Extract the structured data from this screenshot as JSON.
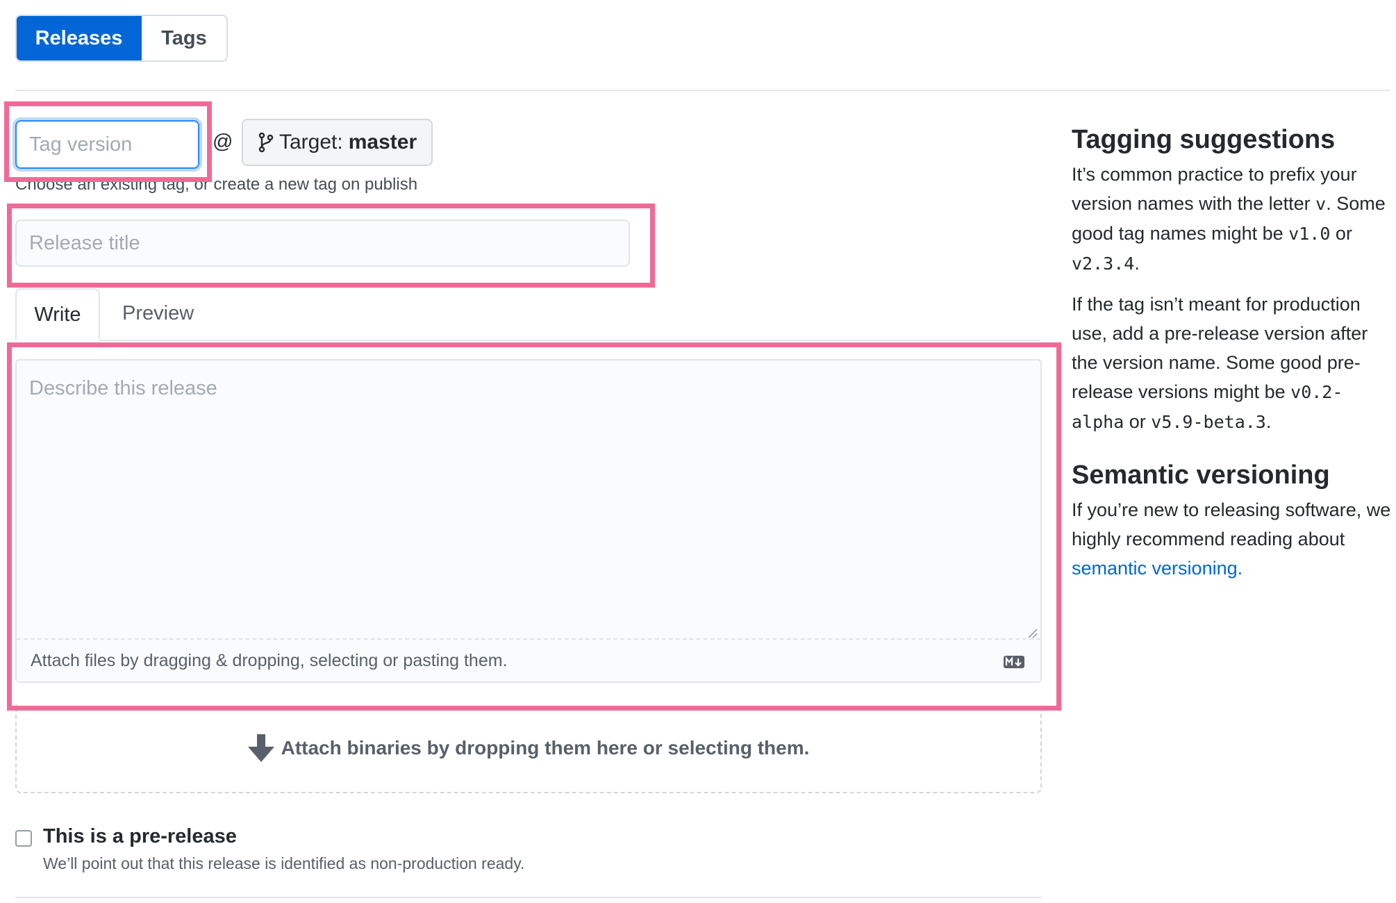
{
  "tabs": {
    "releases": "Releases",
    "tags": "Tags"
  },
  "tag_input": {
    "placeholder": "Tag version"
  },
  "at_sign": "@",
  "target": {
    "label": "Target:",
    "branch": "master"
  },
  "tag_hint": "Choose an existing tag, or create a new tag on publish",
  "release_title": {
    "placeholder": "Release title"
  },
  "editor_tabs": {
    "write": "Write",
    "preview": "Preview"
  },
  "description": {
    "placeholder": "Describe this release"
  },
  "attach_files": "Attach files by dragging & dropping, selecting or pasting them.",
  "attach_binaries": "Attach binaries by dropping them here or selecting them.",
  "prerelease": {
    "label": "This is a pre-release",
    "note": "We’ll point out that this release is identified as non-production ready."
  },
  "sidebar": {
    "tagging_heading": "Tagging suggestions",
    "tagging_p1_a": "It’s common practice to prefix your version names with the letter ",
    "tagging_p1_code1": "v",
    "tagging_p1_b": ". Some good tag names might be ",
    "tagging_p1_code2": "v1.0",
    "tagging_p1_c": " or ",
    "tagging_p1_code3": "v2.3.4",
    "tagging_p1_d": ".",
    "tagging_p2_a": "If the tag isn’t meant for production use, add a pre-release version after the version name. Some good pre-release versions might be ",
    "tagging_p2_code1": "v0.2-alpha",
    "tagging_p2_b": " or ",
    "tagging_p2_code2": "v5.9-beta.3",
    "tagging_p2_c": ".",
    "semver_heading": "Semantic versioning",
    "semver_p_a": "If you’re new to releasing software, we highly recommend reading about ",
    "semver_link": "semantic versioning.",
    "semver_p_b": ""
  },
  "colors": {
    "accent": "#0366d6",
    "highlight": "#f06a96"
  },
  "icons": {
    "target": "git-branch-icon",
    "markdown": "markdown-icon",
    "binaries": "arrow-down-icon"
  }
}
